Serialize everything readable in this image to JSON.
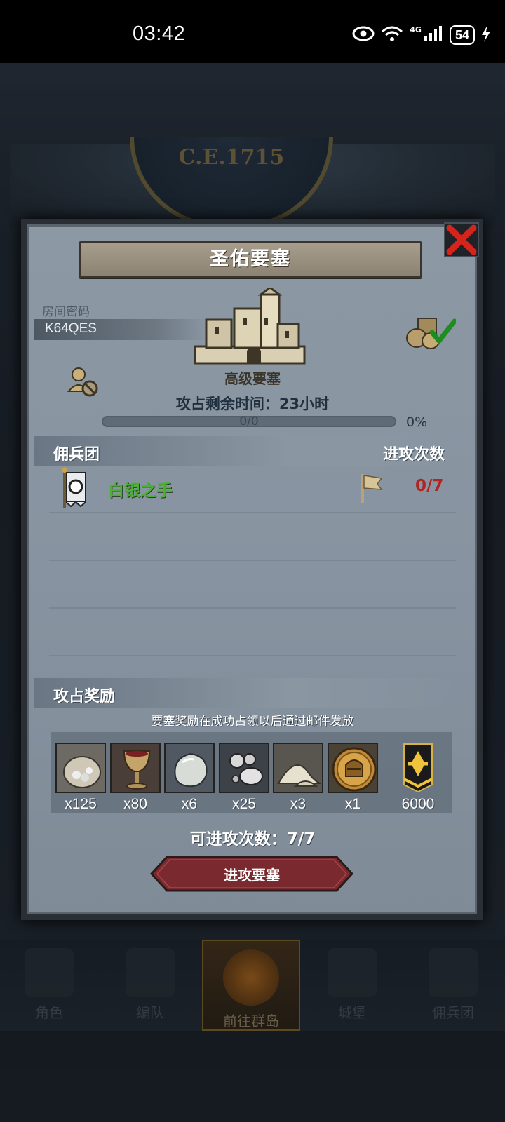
{
  "status_bar": {
    "time": "03:42",
    "network": "4G",
    "battery": "54"
  },
  "background": {
    "era_label": "C.E.1715"
  },
  "dialog": {
    "title": "圣佑要塞",
    "room_code_label": "房间密码",
    "room_code": "K64QES",
    "fort_type": "高级要塞",
    "time_left": "攻占剩余时间：23小时",
    "progress_text": "0/0",
    "progress_percent": "0%",
    "progress_value": 0,
    "mercenary_header": "佣兵团",
    "attack_count_header": "进攻次数",
    "mercenaries": [
      {
        "name": "白银之手",
        "attacks": "0/7"
      }
    ],
    "rewards_header": "攻占奖励",
    "rewards_note": "要塞奖励在成功占领以后通过邮件发放",
    "rewards": [
      {
        "icon": "silver-ore-bag-icon",
        "qty": "x125"
      },
      {
        "icon": "goblet-icon",
        "qty": "x80"
      },
      {
        "icon": "gem-stone-icon",
        "qty": "x6"
      },
      {
        "icon": "silver-pearls-icon",
        "qty": "x25"
      },
      {
        "icon": "salt-pile-icon",
        "qty": "x3"
      },
      {
        "icon": "knight-helmet-coin-icon",
        "qty": "x1"
      },
      {
        "icon": "guild-badge-icon",
        "qty": "6000"
      }
    ],
    "attacks_left": "可进攻次数：7/7",
    "attack_button": "进攻要塞"
  },
  "bottom_nav": [
    {
      "label": "角色",
      "active": false
    },
    {
      "label": "编队",
      "active": false
    },
    {
      "label": "前往群岛",
      "active": true
    },
    {
      "label": "城堡",
      "active": false
    },
    {
      "label": "佣兵团",
      "active": false
    }
  ],
  "colors": {
    "merc_name": "#4ab136",
    "attack_count": "#b02424",
    "close_x": "#d4241c",
    "attack_button": "#7a2a2e"
  }
}
